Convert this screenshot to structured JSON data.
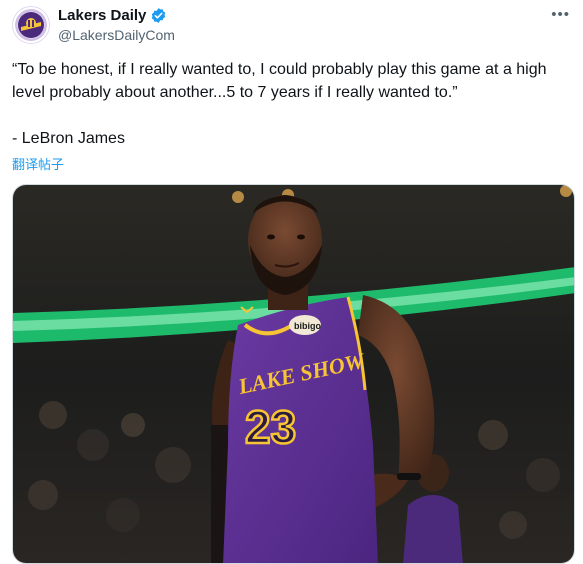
{
  "account": {
    "name": "Lakers Daily",
    "handle": "@LakersDailyCom",
    "avatar_icon": "lakers-daily-logo",
    "verified_icon": "verified-badge-icon",
    "verified_color": "#1d9bf0"
  },
  "menu": {
    "more_label": "•••"
  },
  "tweet": {
    "text": "“To be honest, if I really wanted to, I could probably play this game at a high level probably about another...5 to 7 years if I really wanted to.”\n\n- LeBron James",
    "translate_label": "翻译帖子"
  },
  "photo": {
    "jersey_wordmark": "LAKE SHOW",
    "jersey_number": "23",
    "sponsor_patch": "bibigo",
    "jersey_color": "#5b2e8f",
    "trim_color": "#f7c434",
    "arena_accent": "#1fd67a"
  }
}
